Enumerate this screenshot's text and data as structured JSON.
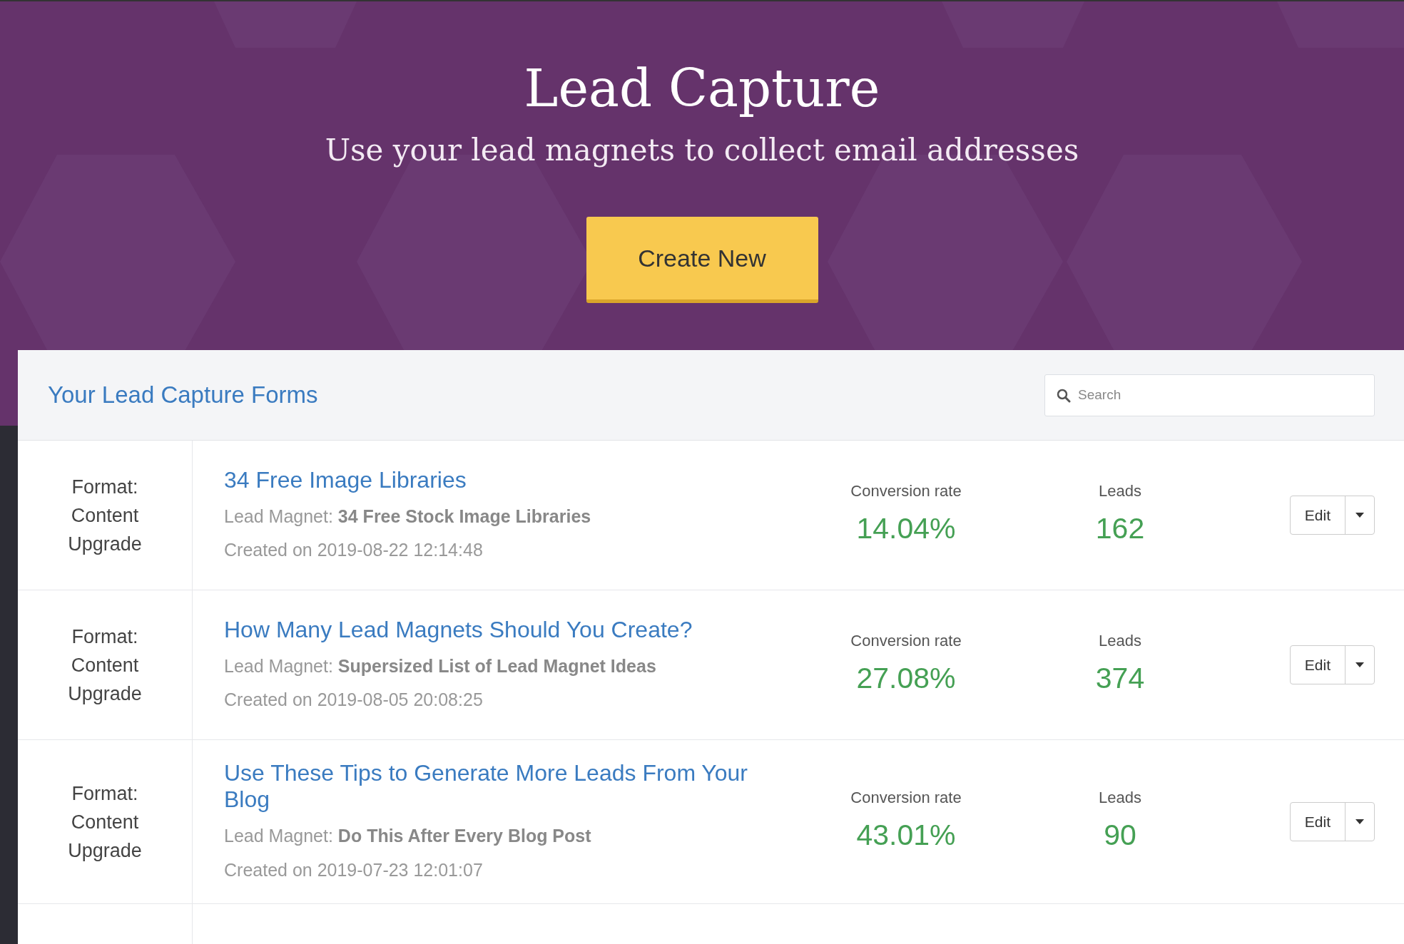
{
  "header": {
    "title": "Lead Capture",
    "subtitle": "Use your lead magnets to collect email addresses",
    "button": "Create New"
  },
  "card": {
    "title": "Your Lead Capture Forms",
    "search": {
      "placeholder": "Search"
    }
  },
  "rows": [
    {
      "format": "Format: Content Upgrade",
      "title": "34 Free Image Libraries",
      "magnet_label": "Lead Magnet:",
      "magnet": "34 Free Stock Image Libraries",
      "created": "Created on 2019-08-22 12:14:48",
      "rate_label": "Conversion rate",
      "rate": "14.04%",
      "leads_label": "Leads",
      "leads": "162",
      "edit": "Edit"
    },
    {
      "format": "Format: Content Upgrade",
      "title": "How Many Lead Magnets Should You Create?",
      "magnet_label": "Lead Magnet:",
      "magnet": "Supersized List of Lead Magnet Ideas",
      "created": "Created on 2019-08-05 20:08:25",
      "rate_label": "Conversion rate",
      "rate": "27.08%",
      "leads_label": "Leads",
      "leads": "374",
      "edit": "Edit"
    },
    {
      "format": "Format: Content Upgrade",
      "title": "Use These Tips to Generate More Leads From Your Blog",
      "magnet_label": "Lead Magnet:",
      "magnet": "Do This After Every Blog Post",
      "created": "Created on 2019-07-23 12:01:07",
      "rate_label": "Conversion rate",
      "rate": "43.01%",
      "leads_label": "Leads",
      "leads": "90",
      "edit": "Edit"
    }
  ]
}
